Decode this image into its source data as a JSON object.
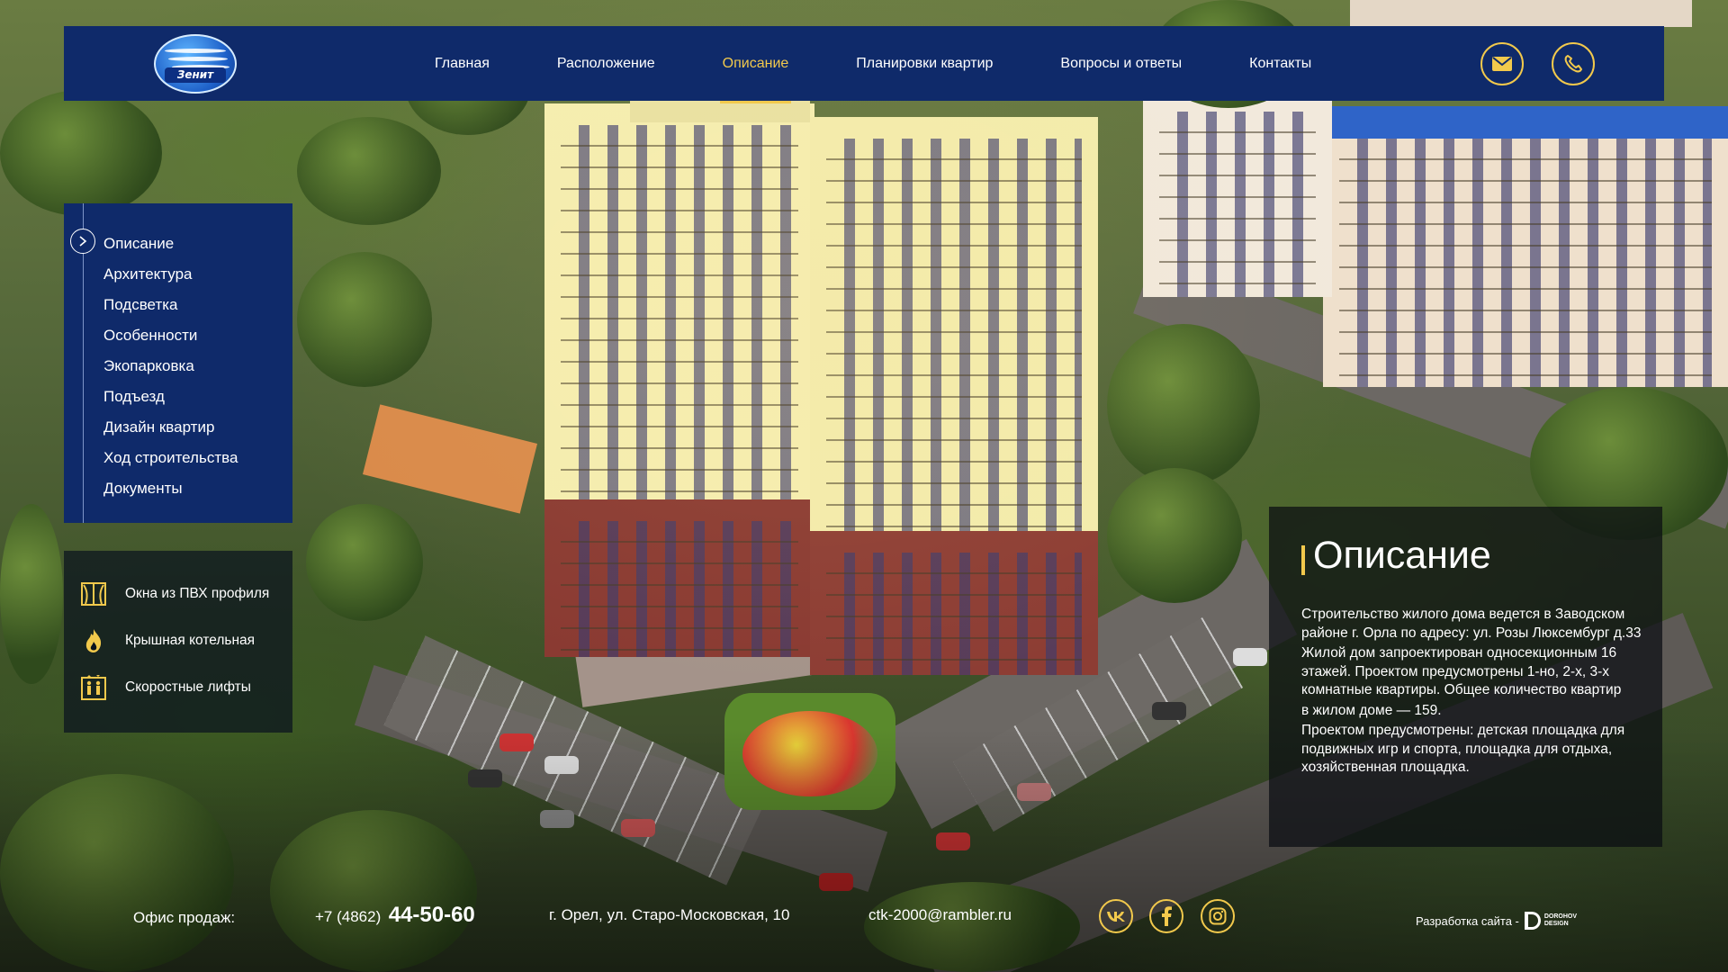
{
  "app": {
    "logo_text": "Зенит"
  },
  "nav": {
    "items": [
      {
        "label": "Главная"
      },
      {
        "label": "Расположение"
      },
      {
        "label": "Описание"
      },
      {
        "label": "Планировки квартир"
      },
      {
        "label": "Вопросы и ответы"
      },
      {
        "label": "Контакты"
      }
    ],
    "active_index": 2
  },
  "submenu": {
    "items": [
      {
        "label": "Описание"
      },
      {
        "label": "Архитектура"
      },
      {
        "label": "Подсветка"
      },
      {
        "label": "Особенности"
      },
      {
        "label": "Экопарковка"
      },
      {
        "label": "Подъезд"
      },
      {
        "label": "Дизайн квартир"
      },
      {
        "label": "Ход строительства"
      },
      {
        "label": "Документы"
      }
    ],
    "active_index": 0
  },
  "features": [
    {
      "icon": "window-icon",
      "label": "Окна из ПВХ профиля"
    },
    {
      "icon": "flame-icon",
      "label": "Крышная котельная"
    },
    {
      "icon": "elevator-icon",
      "label": "Скоростные лифты"
    }
  ],
  "description": {
    "title": "Описание",
    "paragraphs": [
      "Строительство жилого дома ведется в Заводском районе г. Орла по адресу: ул. Розы Люксембург д.33",
      "Жилой дом запроектирован односекционным 16 этажей. Проектом предусмотрены 1-но, 2-х, 3-х комнатные квартиры. Общее количество квартир",
      "в жилом доме — 159.",
      "Проектом предусмотрены: детская площадка для подвижных игр и спорта, площадка для отдыха, хозяйственная площадка."
    ]
  },
  "footer": {
    "office_label": "Офис продаж:",
    "phone_prefix": "+7 (4862)",
    "phone_number": "44-50-60",
    "address": "г. Орел, ул. Старо-Московская, 10",
    "email": "ctk-2000@rambler.ru",
    "social": [
      "vk-icon",
      "facebook-icon",
      "instagram-icon"
    ],
    "developer_label": "Разработка сайта -",
    "developer_brand_line1": "DOROHOV",
    "developer_brand_line2": "DESIGN"
  },
  "colors": {
    "nav_bg": "#0f2a6a",
    "accent": "#f2c94c",
    "panel_dark": "rgba(10,12,18,0.72)"
  }
}
